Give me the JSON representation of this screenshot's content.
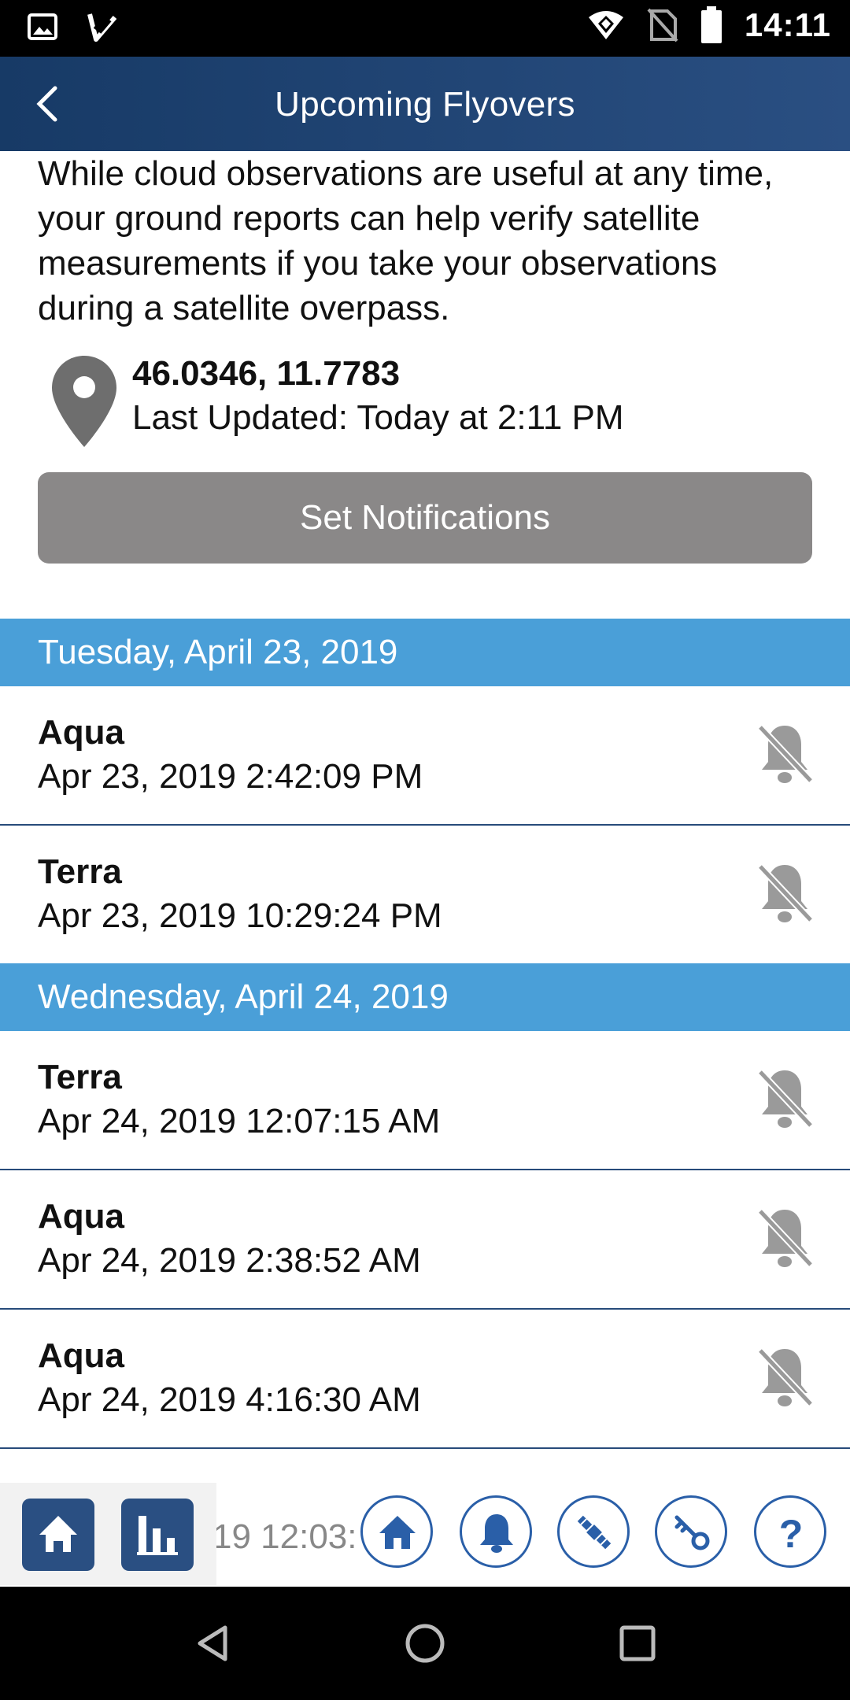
{
  "status_bar": {
    "time": "14:11",
    "icons_left": [
      "image-icon",
      "check-app-icon"
    ],
    "icons_right": [
      "wifi-icon",
      "no-sim-icon",
      "battery-icon"
    ]
  },
  "app_bar": {
    "title": "Upcoming Flyovers",
    "back_icon": "chevron-left-icon"
  },
  "intro_text": "While cloud observations are useful at any time, your ground reports can help verify satellite measurements if you take your observations during a satellite overpass.",
  "location": {
    "coordinates": "46.0346, 11.7783",
    "last_updated": "Last Updated: Today at 2:11 PM"
  },
  "set_notifications_label": "Set Notifications",
  "groups": [
    {
      "date": "Tuesday, April 23, 2019",
      "items": [
        {
          "satellite": "Aqua",
          "time": "Apr 23, 2019 2:42:09 PM"
        },
        {
          "satellite": "Terra",
          "time": "Apr 23, 2019 10:29:24 PM"
        }
      ]
    },
    {
      "date": "Wednesday, April 24, 2019",
      "items": [
        {
          "satellite": "Terra",
          "time": "Apr 24, 2019 12:07:15 AM"
        },
        {
          "satellite": "Aqua",
          "time": "Apr 24, 2019 2:38:52 AM"
        },
        {
          "satellite": "Aqua",
          "time": "Apr 24, 2019 4:16:30 AM"
        }
      ]
    }
  ],
  "partial_row_time": "19 12:03:",
  "colors": {
    "app_bar": "#173a66",
    "date_header": "#4a9fd8",
    "button_gray": "#8a8888",
    "nav_blue": "#2a5fa8",
    "bell_gray": "#9a9a9a"
  },
  "bottom_nav": {
    "left_tools": [
      "home-icon",
      "bar-chart-icon"
    ],
    "circle_buttons": [
      "home-icon",
      "bell-icon",
      "satellite-icon",
      "key-icon",
      "help-icon"
    ],
    "help_glyph": "?"
  }
}
